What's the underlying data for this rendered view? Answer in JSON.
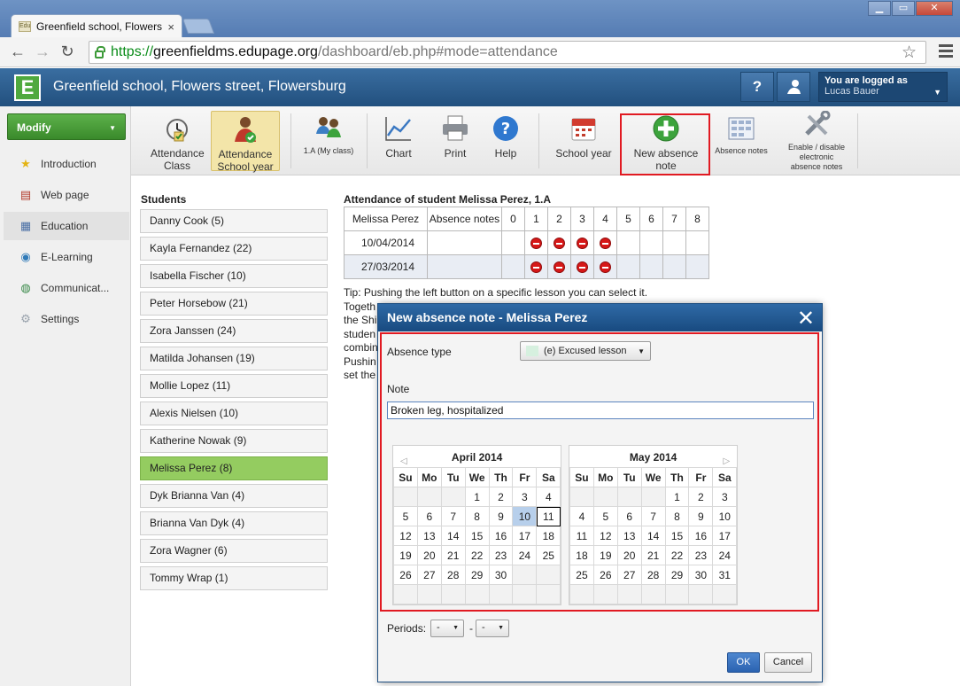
{
  "browser": {
    "tab_title": "Greenfield school, Flowers",
    "tab_favicon_text": "Edu",
    "tab_close": "×",
    "url_scheme": "https://",
    "url_host": "greenfieldms.edupage.org",
    "url_path": "/dashboard/eb.php#mode=attendance"
  },
  "header": {
    "logo": "E",
    "title": "Greenfield school, Flowers street, Flowersburg",
    "help_label": "?",
    "user_line1": "You are logged as",
    "user_line2": "Lucas Bauer"
  },
  "sidebar": {
    "modify": "Modify",
    "items": [
      "Introduction",
      "Web page",
      "Education",
      "E-Learning",
      "Communicat...",
      "Settings"
    ]
  },
  "ribbon": {
    "attendance_class": "Attendance Class",
    "attendance_year": "Attendance School year",
    "my_class": "1.A (My class)",
    "chart": "Chart",
    "print": "Print",
    "help": "Help",
    "school_year": "School year",
    "new_absence": "New absence note",
    "absence_notes": "Absence notes",
    "enable_disable": "Enable / disable electronic absence notes"
  },
  "students": {
    "heading": "Students",
    "list": [
      "Danny Cook (5)",
      "Kayla Fernandez (22)",
      "Isabella Fischer (10)",
      "Peter Horsebow (21)",
      "Zora Janssen (24)",
      "Matilda Johansen (19)",
      "Mollie Lopez (11)",
      "Alexis Nielsen (10)",
      "Katherine Nowak (9)",
      "Melissa Perez (8)",
      "Dyk Brianna Van (4)",
      "Brianna Van Dyk (4)",
      "Zora Wagner (6)",
      "Tommy Wrap (1)"
    ],
    "selected_index": 9
  },
  "attendance": {
    "heading": "Attendance of student Melissa Perez, 1.A",
    "col_student": "Melissa Perez",
    "col_notes": "Absence notes",
    "periods": [
      "0",
      "1",
      "2",
      "3",
      "4",
      "5",
      "6",
      "7",
      "8"
    ],
    "rows": [
      {
        "date": "10/04/2014",
        "absent": [
          1,
          2,
          3,
          4
        ]
      },
      {
        "date": "27/03/2014",
        "absent": [
          1,
          2,
          3,
          4
        ]
      }
    ],
    "tip_lines": [
      "Tip: Pushing the left button on a specific lesson you can select it.",
      "Togeth",
      "the Shi",
      "studen",
      "combin",
      "Pushin",
      "set the"
    ]
  },
  "dialog": {
    "title": "New absence note - Melissa Perez",
    "close": "✕",
    "absence_type_label": "Absence type",
    "absence_type_value": "(e) Excused lesson",
    "note_label": "Note",
    "note_value": "Broken leg, hospitalized",
    "periods_label": "Periods:",
    "period_from": "-",
    "period_to": "-",
    "period_dash": "-",
    "ok": "OK",
    "cancel": "Cancel",
    "dow": [
      "Su",
      "Mo",
      "Tu",
      "We",
      "Th",
      "Fr",
      "Sa"
    ],
    "calendars": [
      {
        "title": "April 2014",
        "weeks": [
          [
            "",
            "",
            "",
            "1",
            "2",
            "3",
            "4"
          ],
          [
            "5",
            "6",
            "7",
            "8",
            "9",
            "10",
            "11"
          ],
          [
            "12",
            "13",
            "14",
            "15",
            "16",
            "17",
            "18"
          ],
          [
            "19",
            "20",
            "21",
            "22",
            "23",
            "24",
            "25"
          ],
          [
            "26",
            "27",
            "28",
            "29",
            "30",
            "",
            ""
          ],
          [
            "",
            "",
            "",
            "",
            "",
            "",
            ""
          ]
        ]
      },
      {
        "title": "May 2014",
        "weeks": [
          [
            "",
            "",
            "",
            "",
            "1",
            "2",
            "3"
          ],
          [
            "4",
            "5",
            "6",
            "7",
            "8",
            "9",
            "10"
          ],
          [
            "11",
            "12",
            "13",
            "14",
            "15",
            "16",
            "17"
          ],
          [
            "18",
            "19",
            "20",
            "21",
            "22",
            "23",
            "24"
          ],
          [
            "25",
            "26",
            "27",
            "28",
            "29",
            "30",
            "31"
          ],
          [
            "",
            "",
            "",
            "",
            "",
            "",
            ""
          ]
        ]
      }
    ]
  },
  "colors": {
    "header_blue": "#22507e",
    "selected_student": "#94cc60",
    "highlight_red": "#e11a22",
    "today_blue": "#b7cfeb"
  }
}
